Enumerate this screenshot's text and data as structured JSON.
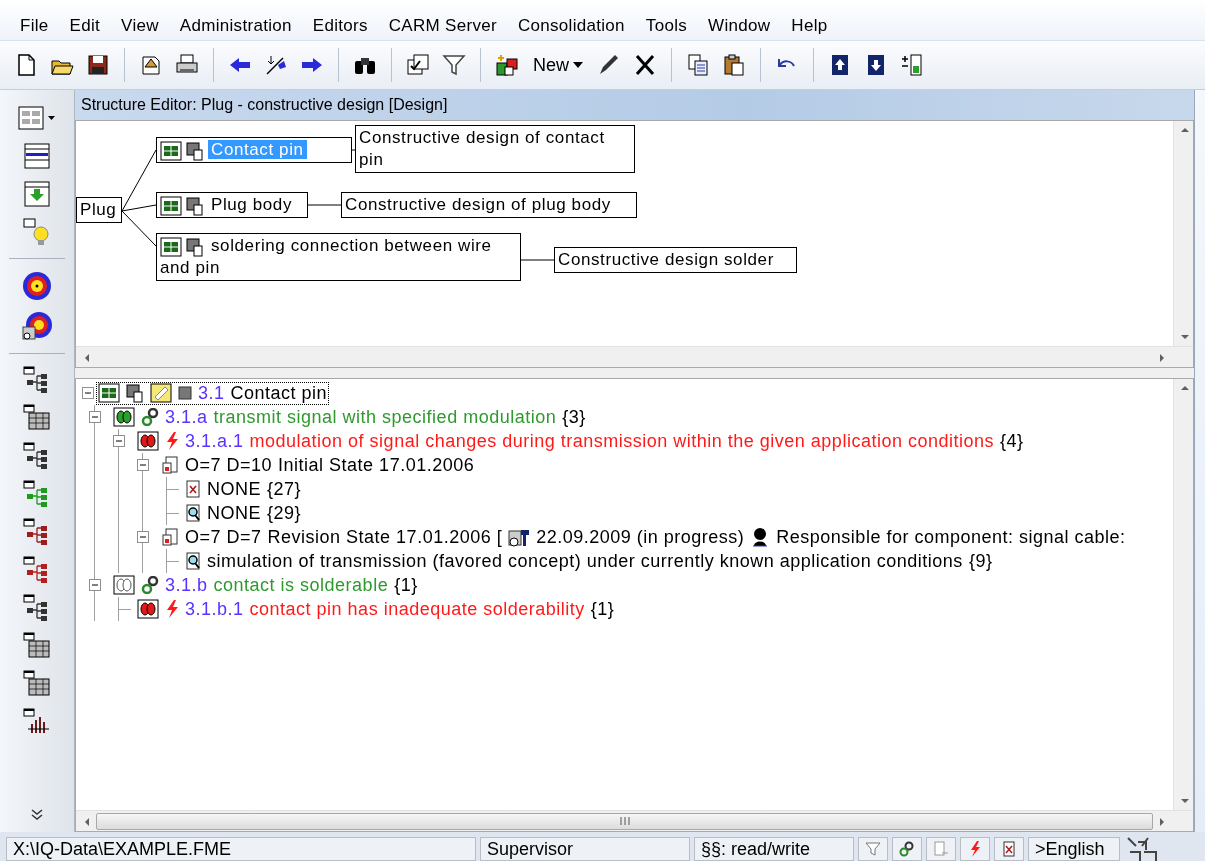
{
  "menu": [
    "File",
    "Edit",
    "View",
    "Administration",
    "Editors",
    "CARM Server",
    "Consolidation",
    "Tools",
    "Window",
    "Help"
  ],
  "toolbar": {
    "new_button": "New"
  },
  "editor": {
    "title": "Structure Editor: Plug - constructive design [Design]"
  },
  "structure": {
    "root": "Plug",
    "children": [
      {
        "label": "Contact pin",
        "selected": true,
        "function": "Constructive design of contact pin"
      },
      {
        "label": "Plug body",
        "selected": false,
        "function": "Constructive design of plug body"
      },
      {
        "label": "soldering connection between wire and pin",
        "selected": false,
        "function": "Constructive design solder"
      }
    ]
  },
  "tree": {
    "kind": "element",
    "id": "3.1",
    "text": "Contact pin",
    "focused": true,
    "expanded": true,
    "children": [
      {
        "kind": "function",
        "id": "3.1.a",
        "text": "transmit signal with specified modulation",
        "count": "{3}",
        "active": true,
        "expanded": true,
        "children": [
          {
            "kind": "failure",
            "id": "3.1.a.1",
            "text": "modulation of signal changes during transmission within the given application conditions",
            "count": "{4}",
            "expanded": true,
            "children": [
              {
                "kind": "state",
                "rating": "O=7 D=10",
                "text": "Initial State 17.01.2006",
                "expanded": true,
                "children": [
                  {
                    "kind": "avoidance",
                    "text": "NONE",
                    "count": "{27}"
                  },
                  {
                    "kind": "detection",
                    "text": "NONE",
                    "count": "{29}"
                  }
                ]
              },
              {
                "kind": "state",
                "rating": "O=7 D=7",
                "text": "Revision State 17.01.2006 [",
                "deadline": "22.09.2009 (in progress)",
                "responsible": "Responsible for component: signal cable:",
                "expanded": true,
                "children": [
                  {
                    "kind": "detection",
                    "text": "simulation of transmission (favored concept) under currently known application conditions",
                    "count": "{9}"
                  }
                ]
              }
            ]
          }
        ]
      },
      {
        "kind": "function",
        "id": "3.1.b",
        "text": "contact is solderable",
        "count": "{1}",
        "active": false,
        "expanded": true,
        "children": [
          {
            "kind": "failure",
            "id": "3.1.b.1",
            "text": "contact pin has inadequate solderability",
            "count": "{1}"
          }
        ]
      }
    ]
  },
  "status_bar": {
    "path": "X:\\IQ-Data\\EXAMPLE.FME",
    "user": "Supervisor",
    "access": "§§: read/write",
    "language": ">English"
  }
}
